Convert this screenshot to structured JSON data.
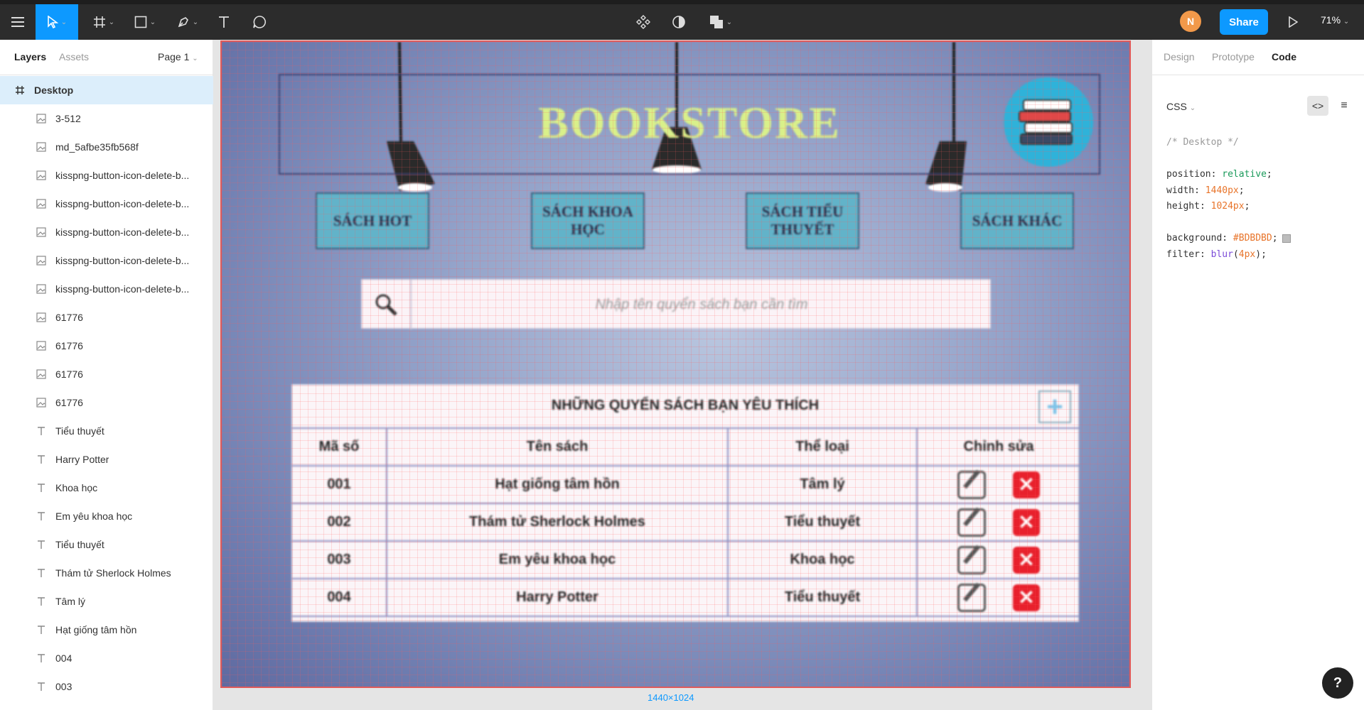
{
  "toolbar": {
    "share_label": "Share",
    "zoom": "71%",
    "avatar_initial": "N"
  },
  "left_panel": {
    "tabs": [
      "Layers",
      "Assets"
    ],
    "page": "Page 1",
    "layers": [
      {
        "name": "Desktop",
        "icon": "frame-icon",
        "selected": true
      },
      {
        "name": "3-512",
        "icon": "image-icon"
      },
      {
        "name": "md_5afbe35fb568f",
        "icon": "image-icon"
      },
      {
        "name": "kisspng-button-icon-delete-b...",
        "icon": "image-icon"
      },
      {
        "name": "kisspng-button-icon-delete-b...",
        "icon": "image-icon"
      },
      {
        "name": "kisspng-button-icon-delete-b...",
        "icon": "image-icon"
      },
      {
        "name": "kisspng-button-icon-delete-b...",
        "icon": "image-icon"
      },
      {
        "name": "kisspng-button-icon-delete-b...",
        "icon": "image-icon"
      },
      {
        "name": "61776",
        "icon": "image-icon"
      },
      {
        "name": "61776",
        "icon": "image-icon"
      },
      {
        "name": "61776",
        "icon": "image-icon"
      },
      {
        "name": "61776",
        "icon": "image-icon"
      },
      {
        "name": "Tiểu thuyết",
        "icon": "text-icon"
      },
      {
        "name": "Harry Potter",
        "icon": "text-icon"
      },
      {
        "name": "Khoa học",
        "icon": "text-icon"
      },
      {
        "name": "Em yêu khoa học",
        "icon": "text-icon"
      },
      {
        "name": "Tiểu thuyết",
        "icon": "text-icon"
      },
      {
        "name": "Thám tử Sherlock Holmes",
        "icon": "text-icon"
      },
      {
        "name": "Tâm lý",
        "icon": "text-icon"
      },
      {
        "name": "Hạt giống tâm hồn",
        "icon": "text-icon"
      },
      {
        "name": "004",
        "icon": "text-icon"
      },
      {
        "name": "003",
        "icon": "text-icon"
      }
    ]
  },
  "canvas": {
    "frame_size_label": "1440×1024",
    "design": {
      "title": "BOOKSTORE",
      "categories": [
        "SÁCH HOT",
        "SÁCH KHOA HỌC",
        "SÁCH TIỂU THUYẾT",
        "SÁCH KHÁC"
      ],
      "search_placeholder": "Nhập tên quyển sách bạn cần tìm",
      "table_title": "NHỮNG QUYỂN SÁCH BẠN YÊU THÍCH",
      "columns": [
        "Mã số",
        "Tên sách",
        "Thể loại",
        "Chỉnh sửa"
      ],
      "rows": [
        {
          "id": "001",
          "name": "Hạt giống tâm hồn",
          "genre": "Tâm lý"
        },
        {
          "id": "002",
          "name": "Thám tử Sherlock Holmes",
          "genre": "Tiểu thuyết"
        },
        {
          "id": "003",
          "name": "Em yêu khoa học",
          "genre": "Khoa học"
        },
        {
          "id": "004",
          "name": "Harry Potter",
          "genre": "Tiểu thuyết"
        }
      ]
    }
  },
  "right_panel": {
    "tabs": [
      "Design",
      "Prototype",
      "Code"
    ],
    "active_tab": "Code",
    "language": "CSS",
    "code": {
      "comment": "/* Desktop */",
      "position_key": "position:",
      "position_val": "relative",
      "width_key": "width:",
      "width_val": "1440px",
      "height_key": "height:",
      "height_val": "1024px",
      "background_key": "background:",
      "background_val": "#BDBDBD",
      "filter_key": "filter:",
      "filter_fn": "blur",
      "filter_arg": "4px"
    }
  },
  "colors": {
    "accent": "#0d99ff",
    "toolbar_bg": "#2c2c2c",
    "title_color": "#d9f08a",
    "delete_red": "#e8202c"
  }
}
